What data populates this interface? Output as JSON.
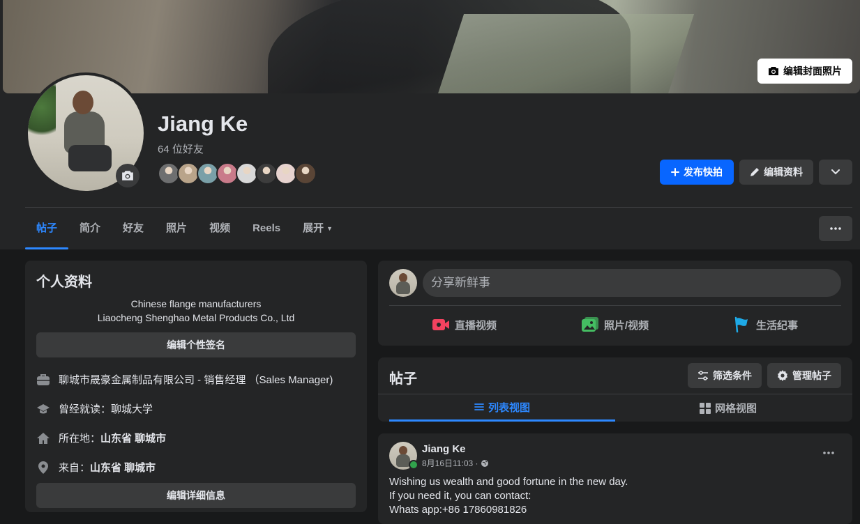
{
  "cover": {
    "edit_label": "编辑封面照片"
  },
  "profile": {
    "name": "Jiang Ke",
    "friends_count": "64 位好友",
    "friend_avatar_colors": [
      "#6e6f70",
      "#b9a48a",
      "#7aa0a8",
      "#c97b8a",
      "#d8d8d8",
      "#3d3d3d",
      "#e7d3cf",
      "#5a4536"
    ]
  },
  "actions": {
    "publish_label": "发布快拍",
    "edit_profile_label": "编辑资料"
  },
  "tabs": [
    {
      "label": "帖子",
      "active": true
    },
    {
      "label": "简介"
    },
    {
      "label": "好友"
    },
    {
      "label": "照片"
    },
    {
      "label": "视频"
    },
    {
      "label": "Reels"
    },
    {
      "label": "展开"
    }
  ],
  "intro": {
    "title": "个人资料",
    "bio_line1": "Chinese flange manufacturers",
    "bio_line2": "Liaocheng Shenghao Metal Products Co., Ltd",
    "edit_bio_label": "编辑个性签名",
    "work": "聊城市晟豪金属制品有限公司 - 销售经理 （Sales Manager)",
    "education_prefix": "曾经就读：",
    "education_value": "聊城大学",
    "lives_prefix": "所在地：",
    "lives_value": "山东省 聊城市",
    "from_prefix": "来自：",
    "from_value": "山东省 聊城市",
    "edit_details_label": "编辑详细信息"
  },
  "composer": {
    "placeholder": "分享新鲜事",
    "live_label": "直播视频",
    "photo_label": "照片/视频",
    "life_event_label": "生活纪事"
  },
  "posts_section": {
    "title": "帖子",
    "filter_label": "筛选条件",
    "manage_label": "管理帖子",
    "list_view_label": "列表视图",
    "grid_view_label": "网格视图"
  },
  "post": {
    "author": "Jiang Ke",
    "time": "8月16日11:03 ·",
    "line1": "Wishing us wealth and good fortune in the new day.",
    "line2": "If you need it, you can contact:",
    "line3": "Whats app:+86 17860981826"
  },
  "colors": {
    "background": "#18191a",
    "card": "#242526",
    "accent": "#0866ff",
    "link_blue": "#2d88ff",
    "button_gray": "#3a3b3c"
  }
}
